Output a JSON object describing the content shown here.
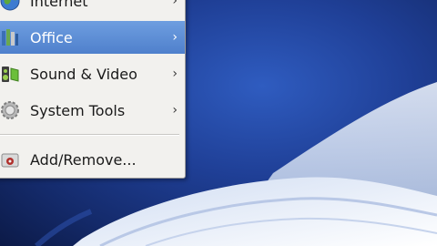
{
  "menu": {
    "items": [
      {
        "label": "Internet",
        "icon": "globe-icon",
        "has_submenu": true,
        "arrow": "›"
      },
      {
        "label": "Office",
        "icon": "office-books-icon",
        "has_submenu": true,
        "arrow": "›",
        "highlighted": true
      },
      {
        "label": "Sound & Video",
        "icon": "sound-video-icon",
        "has_submenu": true,
        "arrow": "›"
      },
      {
        "label": "System Tools",
        "icon": "gear-icon",
        "has_submenu": true,
        "arrow": "›"
      },
      {
        "label": "Add/Remove...",
        "icon": "add-remove-package-icon",
        "has_submenu": false
      }
    ]
  },
  "colors": {
    "highlight": "#5b8bd6",
    "menu_bg": "#f2f1ee",
    "desktop_blue": "#1f3f96"
  }
}
